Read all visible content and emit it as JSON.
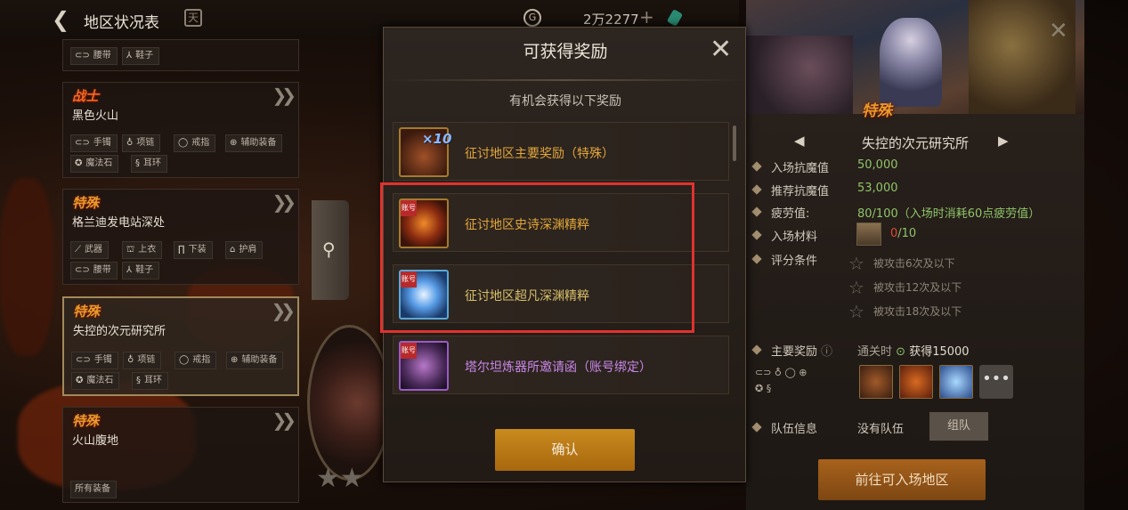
{
  "topbar": {
    "title": "地区状况表",
    "gold_amount": "2万2277"
  },
  "left_list": [
    {
      "badge": "",
      "name": "",
      "tags": [
        "腰带",
        "鞋子"
      ]
    },
    {
      "badge": "战士",
      "name": "黑色火山",
      "tags": [
        "手镯",
        "项链",
        "戒指",
        "辅助装备",
        "魔法石",
        "耳环"
      ]
    },
    {
      "badge": "特殊",
      "name": "格兰迪发电站深处",
      "tags": [
        "武器",
        "上衣",
        "下装",
        "护肩",
        "腰带",
        "鞋子"
      ]
    },
    {
      "badge": "特殊",
      "name": "失控的次元研究所",
      "tags": [
        "手镯",
        "项链",
        "戒指",
        "辅助装备",
        "魔法石",
        "耳环"
      ],
      "selected": true
    },
    {
      "badge": "特殊",
      "name": "火山腹地",
      "tags": [
        "所有装备"
      ]
    }
  ],
  "modal": {
    "title": "可获得奖励",
    "subtitle": "有机会获得以下奖励",
    "items": [
      {
        "label": "征讨地区主要奖励（特殊）",
        "icon": "main-reward-chest-icon",
        "multiplier": "×10",
        "label_color": "#e2a73a"
      },
      {
        "label": "征讨地区史诗深渊精粹",
        "icon": "epic-abyss-essence-icon",
        "ribbon": "账号",
        "label_color": "#e2a73a"
      },
      {
        "label": "征讨地区超凡深渊精粹",
        "icon": "transcendent-abyss-essence-icon",
        "ribbon": "账号",
        "label_color": "#d7c06a"
      },
      {
        "label": "塔尔坦炼器所邀请函（账号绑定）",
        "icon": "invitation-letter-icon",
        "ribbon": "账号",
        "label_color": "#c987e8"
      }
    ],
    "confirm_label": "确认"
  },
  "right_panel": {
    "badge": "特殊",
    "dungeon_name": "失控的次元研究所",
    "entry_label": "入场抗魔值",
    "entry_value": "50,000",
    "recommend_label": "推荐抗魔值",
    "recommend_value": "53,000",
    "fatigue_label": "疲劳值:",
    "fatigue_value": "80/100（入场时消耗60点疲劳值）",
    "material_label": "入场材料",
    "material_have": "0",
    "material_need": "/10",
    "grade_label": "评分条件",
    "grades": [
      "被攻击6次及以下",
      "被攻击12次及以下",
      "被攻击18次及以下"
    ],
    "reward_label": "主要奖励",
    "clear_label": "通关时",
    "clear_reward": "获得15000",
    "team_label": "队伍信息",
    "team_status": "没有队伍",
    "team_button": "组队",
    "go_button": "前往可入场地区"
  },
  "colors": {
    "accent_gold": "#c98a1e",
    "highlight_red": "#e0322e",
    "value_green": "#8fc46a"
  }
}
